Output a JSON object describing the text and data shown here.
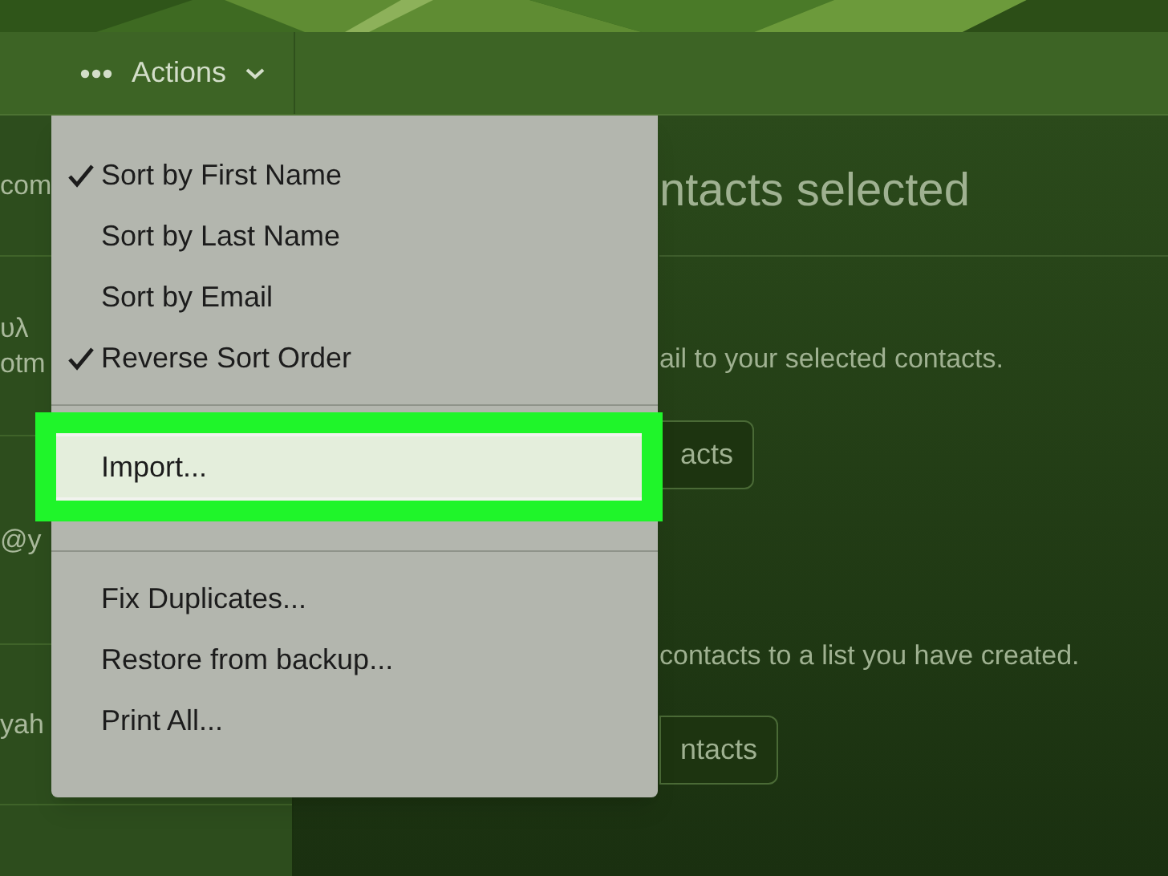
{
  "toolbar": {
    "actions_label": "Actions"
  },
  "sidebar": {
    "items": [
      {
        "lines": [
          "com"
        ]
      },
      {
        "lines": [
          "υλ",
          "otm"
        ]
      },
      {
        "lines": [
          "@y"
        ]
      },
      {
        "lines": [
          "yah"
        ]
      }
    ]
  },
  "main": {
    "heading": "ntacts selected",
    "sections": [
      {
        "description": "ail to your selected contacts.",
        "button": "acts"
      },
      {
        "description": "contacts to a list you have created.",
        "button": "ntacts"
      }
    ]
  },
  "menu": {
    "groups": [
      [
        {
          "label": "Sort by First Name",
          "checked": true,
          "selected": false
        },
        {
          "label": "Sort by Last Name",
          "checked": false,
          "selected": false
        },
        {
          "label": "Sort by Email",
          "checked": false,
          "selected": false
        },
        {
          "label": "Reverse Sort Order",
          "checked": true,
          "selected": false
        }
      ],
      [
        {
          "label": "Import...",
          "checked": false,
          "selected": true
        }
      ],
      [
        {
          "label": "Fix Duplicates...",
          "checked": false,
          "selected": false
        },
        {
          "label": "Restore from backup...",
          "checked": false,
          "selected": false
        },
        {
          "label": "Print All...",
          "checked": false,
          "selected": false
        }
      ]
    ]
  }
}
